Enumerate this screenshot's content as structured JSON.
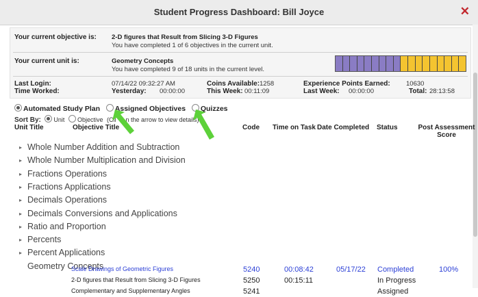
{
  "window": {
    "title": "Student Progress Dashboard: Bill Joyce",
    "close_symbol": "✕"
  },
  "objective": {
    "label": "Your current objective is:",
    "name": "2-D figures that Result from Slicing 3-D Figures",
    "detail": "You have completed 1 of 6 objectives in the current unit."
  },
  "unit": {
    "label": "Your current unit is:",
    "name": "Geometry Concepts",
    "detail": "You have completed 9 of 18 units in the current level.",
    "progress": {
      "total_units": 18,
      "completed_units": 9,
      "completed_color": "#8a7cc4",
      "remaining_color": "#f4c430"
    }
  },
  "stats": {
    "last_login_label": "Last Login:",
    "last_login": "07/14/22 09:32:27 AM",
    "time_worked_label": "Time Worked:",
    "yesterday_label": "Yesterday:",
    "yesterday": "00:00:00",
    "coins_label": "Coins Available:",
    "coins": "1258",
    "this_week_label": "This Week:",
    "this_week": "00:11:09",
    "xp_label": "Experience Points Earned:",
    "xp": "10630",
    "last_week_label": "Last Week:",
    "last_week": "00:00:00",
    "total_label": "Total:",
    "total": "28:13:58"
  },
  "view_options": [
    "Automated Study Plan",
    "Assigned Objectives",
    "Quizzes"
  ],
  "sort": {
    "label": "Sort By:",
    "opt_unit": "Unit",
    "opt_objective": "Objective",
    "hint_a": "(Cli",
    "hint_b": "n the arrow to view details)"
  },
  "columns": {
    "unit_title": "Unit Title",
    "objective_title": "Objective Title",
    "code": "Code",
    "time_on_task": "Time on Task",
    "date_completed": "Date Completed",
    "status": "Status",
    "post_a": "Post Assessment",
    "post_b": "Score"
  },
  "units": [
    "Whole Number Addition and Subtraction",
    "Whole Number Multiplication and Division",
    "Fractions Operations",
    "Fractions Applications",
    "Decimals Operations",
    "Decimals Conversions and Applications",
    "Ratio and Proportion",
    "Percents",
    "Percent Applications",
    "Geometry Concepts"
  ],
  "objectives": [
    {
      "title": "Scale Drawings of Geometric Figures",
      "code": "5240",
      "time": "00:08:42",
      "date": "05/17/22",
      "status": "Completed",
      "score": "100%"
    },
    {
      "title": "2-D figures that Result from Slicing 3-D Figures",
      "code": "5250",
      "time": "00:15:11",
      "date": "",
      "status": "In Progress",
      "score": ""
    },
    {
      "title": "Complementary and Supplementary Angles",
      "code": "5241",
      "time": "",
      "date": "",
      "status": "Assigned",
      "score": ""
    }
  ],
  "colors": {
    "link": "#2b3fd6",
    "annotation_arrow": "#5dd13a",
    "close": "#c1272d"
  }
}
